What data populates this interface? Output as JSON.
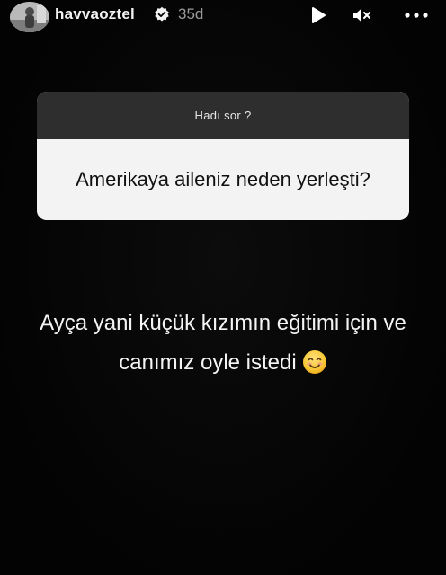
{
  "header": {
    "username": "havvaoztel",
    "time": "35d",
    "icons": {
      "avatar": "profile-avatar",
      "verified": "verified-badge-icon",
      "play": "play-icon",
      "mute": "mute-icon",
      "more": "more-options-icon"
    }
  },
  "question_sticker": {
    "title": "Hadı sor ?",
    "question": "Amerikaya aileniz neden yerleşti?"
  },
  "answer": {
    "line1": "Ayça yani küçük kızımın eğitimi için ve",
    "line2": "canımız oyle istedi",
    "emoji": "smiling-face-emoji"
  },
  "colors": {
    "background": "#050505",
    "sticker_header": "#2e2e2e",
    "sticker_body": "#f3f3f3",
    "emoji_yellow": "#f7c531"
  }
}
